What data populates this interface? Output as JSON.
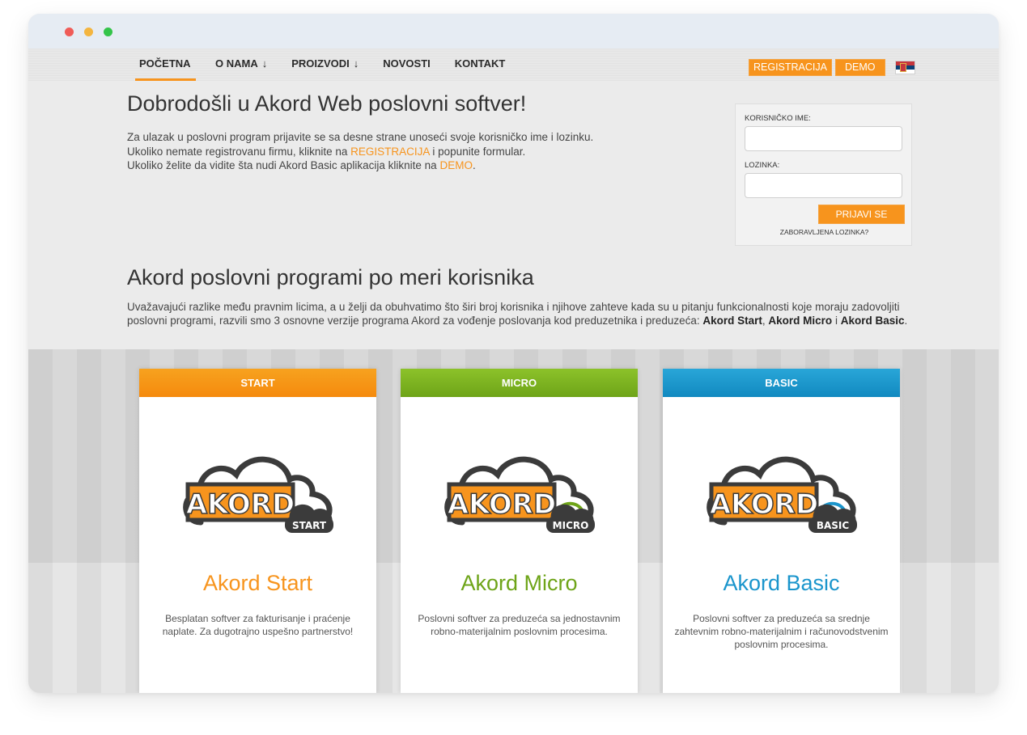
{
  "nav": {
    "items": [
      {
        "label": "POČETNA",
        "arrow": ""
      },
      {
        "label": "O NAMA",
        "arrow": "↓"
      },
      {
        "label": "PROIZVODI",
        "arrow": "↓"
      },
      {
        "label": "NOVOSTI",
        "arrow": ""
      },
      {
        "label": "KONTAKT",
        "arrow": ""
      }
    ],
    "register_label": "REGISTRACIJA",
    "demo_label": "DEMO",
    "flag_icon": "serbian-flag-icon"
  },
  "welcome": {
    "title": "Dobrodošli u Akord Web poslovni softver!",
    "line1": "Za ulazak u poslovni program prijavite se sa desne strane unoseći svoje korisničko ime i lozinku.",
    "line2_before": "Ukoliko nemate registrovanu firmu, kliknite na ",
    "line2_link": "REGISTRACIJA",
    "line2_after": " i popunite formular.",
    "line3_before": "Ukoliko želite da vidite šta nudi Akord Basic aplikacija kliknite na ",
    "line3_link": "DEMO",
    "line3_after": "."
  },
  "login": {
    "username_label": "KORISNIČKO IME:",
    "username_value": "",
    "password_label": "LOZINKA:",
    "password_value": "",
    "submit_label": "PRIJAVI SE",
    "forgot_label": "ZABORAVLJENA LOZINKA?"
  },
  "programs": {
    "title": "Akord poslovni programi po meri korisnika",
    "desc_before": "Uvažavajući razlike među pravnim licima, a u želji da obuhvatimo što širi broj korisnika i njihove zahteve kada su u pitanju funkcionalnosti koje moraju zadovoljiti poslovni programi, razvili smo 3 osnovne verzije programa Akord za vođenje poslovanja kod preduzetnika i preduzeća: ",
    "bold1": "Akord Start",
    "sep1": ", ",
    "bold2": "Akord Micro",
    "sep2": " i ",
    "bold3": "Akord Basic",
    "desc_end": "."
  },
  "cards": [
    {
      "header": "START",
      "logo_word": "AKORD",
      "logo_badge": "START",
      "name": "Akord Start",
      "text": "Besplatan softver za fakturisanje i praćenje naplate. Za dugotrajno uspešno partnerstvo!",
      "color": "#f7941d"
    },
    {
      "header": "MICRO",
      "logo_word": "AKORD",
      "logo_badge": "MICRO",
      "name": "Akord Micro",
      "text": "Poslovni softver za preduzeća sa jednostavnim robno-materijalnim poslovnim procesima.",
      "color": "#6ea418"
    },
    {
      "header": "BASIC",
      "logo_word": "AKORD",
      "logo_badge": "BASIC",
      "name": "Akord Basic",
      "text": "Poslovni softver za preduzeća sa srednje zahtevnim robno-materijalnim i računovodstvenim poslovnim procesima.",
      "color": "#1a95cc"
    }
  ],
  "colors": {
    "accent": "#f7941d",
    "start": "#f7941d",
    "micro": "#6ea418",
    "basic": "#1a95cc"
  }
}
